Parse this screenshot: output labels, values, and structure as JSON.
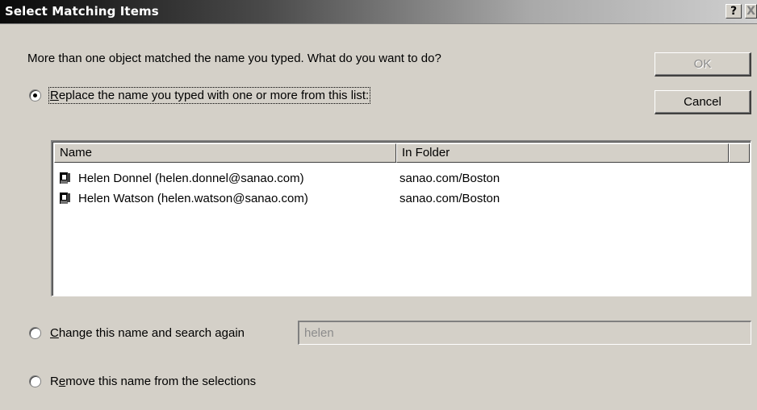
{
  "window": {
    "title": "Select Matching Items",
    "help_label": "?",
    "close_label": "X"
  },
  "prompt": "More than one object matched the name you typed.  What do you want to do?",
  "buttons": {
    "ok_label": "OK",
    "cancel_label": "Cancel"
  },
  "options": {
    "replace": {
      "mnemonic": "R",
      "rest": "eplace the name you typed with one or more from this list:",
      "selected": true
    },
    "change": {
      "mnemonic": "C",
      "rest": "hange this name and search again",
      "selected": false
    },
    "remove": {
      "pre": "R",
      "mnemonic": "e",
      "rest": "move this name from the selections",
      "selected": false
    }
  },
  "list": {
    "columns": [
      "Name",
      "In Folder"
    ],
    "rows": [
      {
        "name": "Helen Donnel (helen.donnel@sanao.com)",
        "folder": "sanao.com/Boston",
        "icon": "user-icon"
      },
      {
        "name": "Helen Watson (helen.watson@sanao.com)",
        "folder": "sanao.com/Boston",
        "icon": "user-icon"
      }
    ]
  },
  "search": {
    "value": "helen"
  }
}
